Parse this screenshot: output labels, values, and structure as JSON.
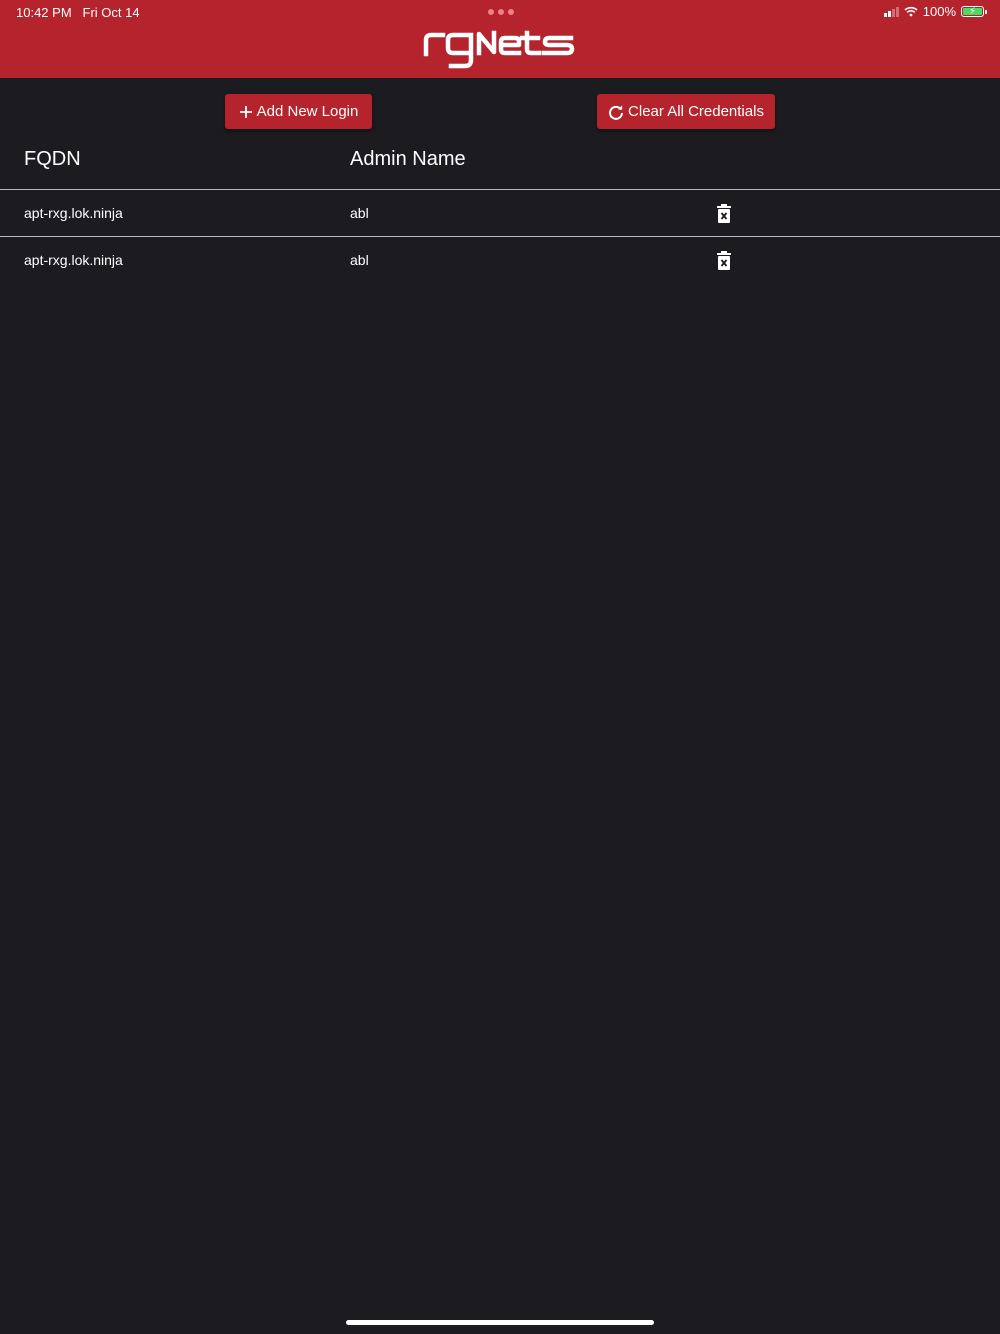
{
  "status_bar": {
    "time": "10:42 PM",
    "date": "Fri Oct 14",
    "battery": "100%",
    "icons": [
      "multitasking-dots-icon",
      "signal-icon",
      "wifi-icon",
      "battery-charging-icon"
    ]
  },
  "header": {
    "logo_text": "rgNets",
    "background_color": "#b5232c"
  },
  "toolbar": {
    "add_label": "Add New Login",
    "add_icon": "plus-icon",
    "clear_label": "Clear All Credentials",
    "clear_icon": "refresh-icon"
  },
  "table": {
    "columns": [
      "FQDN",
      "Admin Name"
    ],
    "rows": [
      {
        "fqdn": "apt-rxg.lok.ninja",
        "admin": "abl",
        "action_icon": "trash-icon"
      },
      {
        "fqdn": "apt-rxg.lok.ninja",
        "admin": "abl",
        "action_icon": "trash-icon"
      }
    ]
  },
  "colors": {
    "accent": "#b5232c",
    "background": "#1c1b20",
    "text": "#ffffff"
  }
}
